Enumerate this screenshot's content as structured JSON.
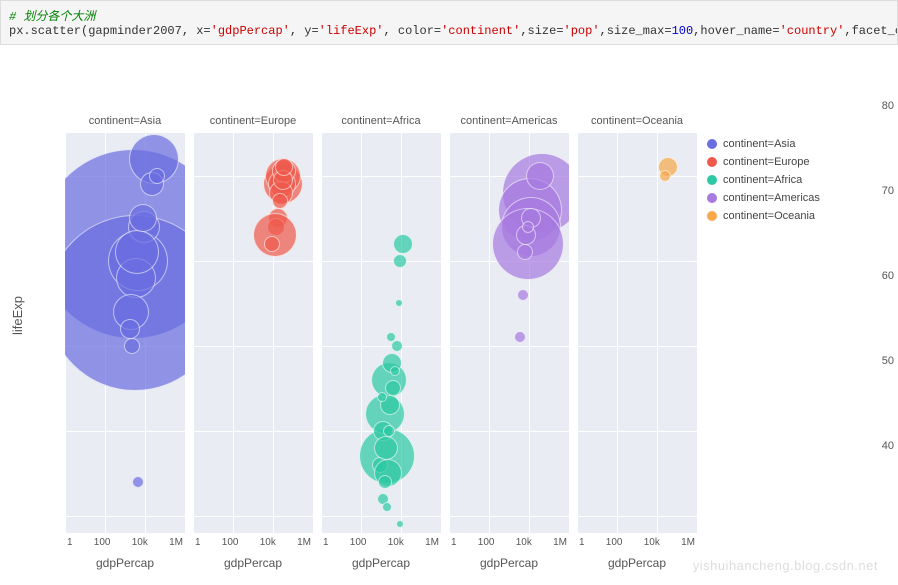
{
  "code": {
    "comment": "# 划分各个大洲",
    "line": "px.scatter(gapminder2007, x='gdpPercap', y='lifeExp', color='continent',size='pop',size_max=100,hover_name='country',facet_col="
  },
  "watermark": "yishuihancheng.blog.csdn.net",
  "chart_data": {
    "type": "scatter",
    "ylabel": "lifeExp",
    "ylim": [
      38,
      85
    ],
    "yticks": [
      40,
      50,
      60,
      70,
      80
    ],
    "xlabel": "gdpPercap",
    "xscale": "log",
    "xlim": [
      1,
      1000000
    ],
    "xticks": [
      "1",
      "100",
      "10k",
      "1M"
    ],
    "size_field": "pop",
    "size_max": 100,
    "hover_field": "country",
    "facet_col": "continent",
    "legend": [
      {
        "label": "continent=Asia",
        "color": "#6b6ee0"
      },
      {
        "label": "continent=Europe",
        "color": "#ef5a4c"
      },
      {
        "label": "continent=Africa",
        "color": "#2dc9a4"
      },
      {
        "label": "continent=Americas",
        "color": "#a77ae0"
      },
      {
        "label": "continent=Oceania",
        "color": "#f7a84a"
      }
    ],
    "facets": [
      {
        "title": "continent=Asia",
        "color": "#6b6ee0",
        "points": [
          {
            "x": 2500,
            "y": 72,
            "r": 95
          },
          {
            "x": 3000,
            "y": 65,
            "r": 88
          },
          {
            "x": 4500,
            "y": 70,
            "r": 30
          },
          {
            "x": 3500,
            "y": 68,
            "r": 20
          },
          {
            "x": 2000,
            "y": 64,
            "r": 18
          },
          {
            "x": 28000,
            "y": 82,
            "r": 25
          },
          {
            "x": 9000,
            "y": 74,
            "r": 16
          },
          {
            "x": 4000,
            "y": 71,
            "r": 22
          },
          {
            "x": 7500,
            "y": 75,
            "r": 14
          },
          {
            "x": 23000,
            "y": 79,
            "r": 12
          },
          {
            "x": 1800,
            "y": 62,
            "r": 10
          },
          {
            "x": 4700,
            "y": 44,
            "r": 6
          },
          {
            "x": 2200,
            "y": 60,
            "r": 8
          },
          {
            "x": 40000,
            "y": 80,
            "r": 8
          }
        ]
      },
      {
        "title": "continent=Europe",
        "color": "#ef5a4c",
        "points": [
          {
            "x": 30000,
            "y": 79,
            "r": 20
          },
          {
            "x": 33000,
            "y": 80,
            "r": 18
          },
          {
            "x": 28000,
            "y": 79,
            "r": 14
          },
          {
            "x": 35000,
            "y": 80.5,
            "r": 12
          },
          {
            "x": 25000,
            "y": 78,
            "r": 12
          },
          {
            "x": 31000,
            "y": 79.5,
            "r": 10
          },
          {
            "x": 36000,
            "y": 81,
            "r": 9
          },
          {
            "x": 18000,
            "y": 75,
            "r": 10
          },
          {
            "x": 14000,
            "y": 74,
            "r": 9
          },
          {
            "x": 12000,
            "y": 73,
            "r": 22
          },
          {
            "x": 9000,
            "y": 72,
            "r": 8
          },
          {
            "x": 22000,
            "y": 77,
            "r": 8
          }
        ]
      },
      {
        "title": "continent=Africa",
        "color": "#2dc9a4",
        "points": [
          {
            "x": 12000,
            "y": 72,
            "r": 10
          },
          {
            "x": 9000,
            "y": 70,
            "r": 7
          },
          {
            "x": 2000,
            "y": 47,
            "r": 28
          },
          {
            "x": 1500,
            "y": 52,
            "r": 20
          },
          {
            "x": 2500,
            "y": 56,
            "r": 18
          },
          {
            "x": 3500,
            "y": 58,
            "r": 10
          },
          {
            "x": 1200,
            "y": 50,
            "r": 10
          },
          {
            "x": 4000,
            "y": 55,
            "r": 8
          },
          {
            "x": 900,
            "y": 46,
            "r": 8
          },
          {
            "x": 1800,
            "y": 48,
            "r": 12
          },
          {
            "x": 2800,
            "y": 53,
            "r": 10
          },
          {
            "x": 2200,
            "y": 45,
            "r": 14
          },
          {
            "x": 1600,
            "y": 44,
            "r": 7
          },
          {
            "x": 1300,
            "y": 42,
            "r": 6
          },
          {
            "x": 2500,
            "y": 50,
            "r": 6
          },
          {
            "x": 6000,
            "y": 60,
            "r": 6
          },
          {
            "x": 2000,
            "y": 41,
            "r": 5
          },
          {
            "x": 3000,
            "y": 61,
            "r": 5
          },
          {
            "x": 5000,
            "y": 57,
            "r": 5
          },
          {
            "x": 1100,
            "y": 54,
            "r": 5
          },
          {
            "x": 7500,
            "y": 65,
            "r": 4
          },
          {
            "x": 8500,
            "y": 39,
            "r": 4
          }
        ]
      },
      {
        "title": "continent=Americas",
        "color": "#a77ae0",
        "points": [
          {
            "x": 43000,
            "y": 78,
            "r": 40
          },
          {
            "x": 11000,
            "y": 76,
            "r": 32
          },
          {
            "x": 13000,
            "y": 74,
            "r": 30
          },
          {
            "x": 9000,
            "y": 72,
            "r": 36
          },
          {
            "x": 36000,
            "y": 80,
            "r": 14
          },
          {
            "x": 12500,
            "y": 75,
            "r": 10
          },
          {
            "x": 7000,
            "y": 73,
            "r": 10
          },
          {
            "x": 6000,
            "y": 71,
            "r": 8
          },
          {
            "x": 5000,
            "y": 66,
            "r": 6
          },
          {
            "x": 3500,
            "y": 61,
            "r": 6
          },
          {
            "x": 8500,
            "y": 74,
            "r": 6
          }
        ]
      },
      {
        "title": "continent=Oceania",
        "color": "#f7a84a",
        "points": [
          {
            "x": 34000,
            "y": 81,
            "r": 10
          },
          {
            "x": 25000,
            "y": 80,
            "r": 6
          }
        ]
      }
    ]
  }
}
